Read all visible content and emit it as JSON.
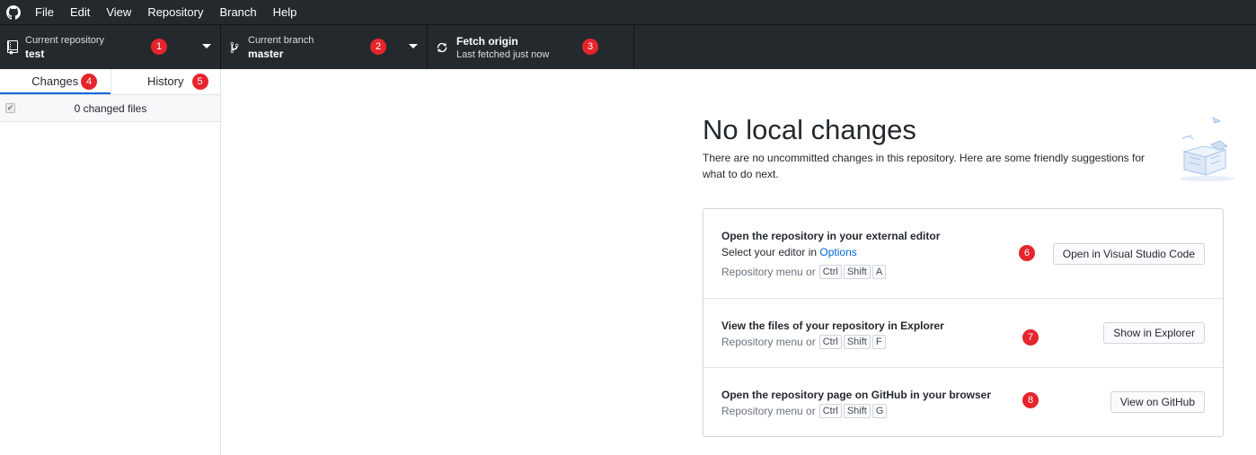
{
  "menu": {
    "items": [
      {
        "label": "File"
      },
      {
        "label": "Edit"
      },
      {
        "label": "View"
      },
      {
        "label": "Repository"
      },
      {
        "label": "Branch"
      },
      {
        "label": "Help"
      }
    ]
  },
  "toolbar": {
    "repo": {
      "desc": "Current repository",
      "value": "test",
      "badge": "1"
    },
    "branch": {
      "desc": "Current branch",
      "value": "master",
      "badge": "2"
    },
    "fetch": {
      "title": "Fetch origin",
      "desc": "Last fetched just now",
      "badge": "3"
    }
  },
  "sidebar": {
    "tabs": [
      {
        "label": "Changes",
        "badge": "4"
      },
      {
        "label": "History",
        "badge": "5"
      }
    ],
    "changes_count": "0 changed files"
  },
  "main": {
    "heading": "No local changes",
    "subtext": "There are no uncommitted changes in this repository. Here are some friendly suggestions for what to do next.",
    "suggestions": [
      {
        "title": "Open the repository in your external editor",
        "line_prefix": "Select your editor in",
        "line_link": "Options",
        "hint": "Repository menu or",
        "keys": [
          "Ctrl",
          "Shift",
          "A"
        ],
        "button": "Open in Visual Studio Code",
        "badge": "6"
      },
      {
        "title": "View the files of your repository in Explorer",
        "hint": "Repository menu or",
        "keys": [
          "Ctrl",
          "Shift",
          "F"
        ],
        "button": "Show in Explorer",
        "badge": "7"
      },
      {
        "title": "Open the repository page on GitHub in your browser",
        "hint": "Repository menu or",
        "keys": [
          "Ctrl",
          "Shift",
          "G"
        ],
        "button": "View on GitHub",
        "badge": "8"
      }
    ]
  },
  "colors": {
    "chrome": "#24292e",
    "accent": "#0366d6",
    "badge": "#e5252c"
  }
}
